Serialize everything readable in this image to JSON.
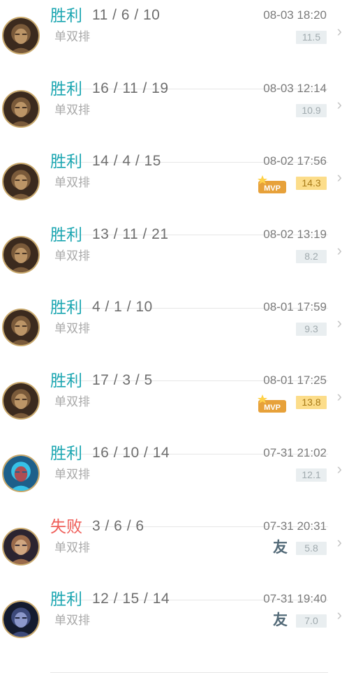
{
  "matches": [
    {
      "result": "胜利",
      "outcome": "win",
      "kda": "11 / 6 / 10",
      "mode": "单双排",
      "time": "08-03 18:20",
      "score": "11.5",
      "mvp": false,
      "friend": "",
      "mvp_label": "",
      "hero_icon": "hero-gold-avatar-icon"
    },
    {
      "result": "胜利",
      "outcome": "win",
      "kda": "16 / 11 / 19",
      "mode": "单双排",
      "time": "08-03 12:14",
      "score": "10.9",
      "mvp": false,
      "friend": "",
      "mvp_label": "",
      "hero_icon": "hero-gold-avatar-icon"
    },
    {
      "result": "胜利",
      "outcome": "win",
      "kda": "14 / 4 / 15",
      "mode": "单双排",
      "time": "08-02 17:56",
      "score": "14.3",
      "mvp": true,
      "friend": "",
      "mvp_label": "MVP",
      "hero_icon": "hero-gold-avatar-icon"
    },
    {
      "result": "胜利",
      "outcome": "win",
      "kda": "13 / 11 / 21",
      "mode": "单双排",
      "time": "08-02 13:19",
      "score": "8.2",
      "mvp": false,
      "friend": "",
      "mvp_label": "",
      "hero_icon": "hero-gold-avatar-icon"
    },
    {
      "result": "胜利",
      "outcome": "win",
      "kda": "4 / 1 / 10",
      "mode": "单双排",
      "time": "08-01 17:59",
      "score": "9.3",
      "mvp": false,
      "friend": "",
      "mvp_label": "",
      "hero_icon": "hero-gold-avatar-icon"
    },
    {
      "result": "胜利",
      "outcome": "win",
      "kda": "17 / 3 / 5",
      "mode": "单双排",
      "time": "08-01 17:25",
      "score": "13.8",
      "mvp": true,
      "friend": "",
      "mvp_label": "MVP",
      "hero_icon": "hero-gold-avatar-icon"
    },
    {
      "result": "胜利",
      "outcome": "win",
      "kda": "16 / 10 / 14",
      "mode": "单双排",
      "time": "07-31 21:02",
      "score": "12.1",
      "mvp": false,
      "friend": "",
      "mvp_label": "",
      "hero_icon": "hero-cyan-avatar-icon"
    },
    {
      "result": "失败",
      "outcome": "loss",
      "kda": "3 / 6 / 6",
      "mode": "单双排",
      "time": "07-31 20:31",
      "score": "5.8",
      "mvp": false,
      "friend": "友",
      "mvp_label": "",
      "hero_icon": "hero-brown-avatar-icon"
    },
    {
      "result": "胜利",
      "outcome": "win",
      "kda": "12 / 15 / 14",
      "mode": "单双排",
      "time": "07-31 19:40",
      "score": "7.0",
      "mvp": false,
      "friend": "友",
      "mvp_label": "",
      "hero_icon": "hero-dark-avatar-icon"
    }
  ],
  "colors": {
    "win": "#1ba6b1",
    "loss": "#ef5d58",
    "mvp_score_bg": "#fcdd8a",
    "score_bg": "#e9eef0",
    "friend": "#536a78"
  }
}
